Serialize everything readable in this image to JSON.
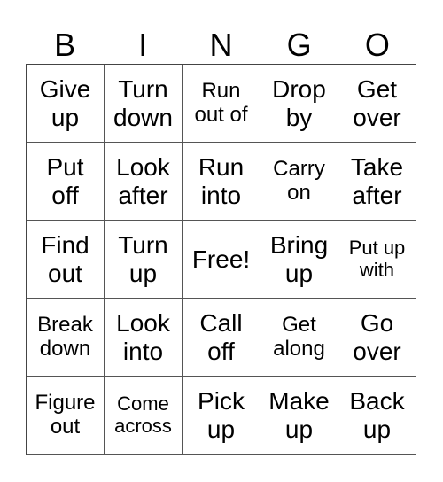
{
  "header": {
    "letters": [
      "B",
      "I",
      "N",
      "G",
      "O"
    ]
  },
  "card": {
    "rows": [
      [
        {
          "line1": "Give",
          "line2": "up",
          "size": "lg"
        },
        {
          "line1": "Turn",
          "line2": "down",
          "size": "lg"
        },
        {
          "line1": "Run",
          "line2": "out of",
          "size": "md"
        },
        {
          "line1": "Drop",
          "line2": "by",
          "size": "lg"
        },
        {
          "line1": "Get",
          "line2": "over",
          "size": "lg"
        }
      ],
      [
        {
          "line1": "Put",
          "line2": "off",
          "size": "lg"
        },
        {
          "line1": "Look",
          "line2": "after",
          "size": "lg"
        },
        {
          "line1": "Run",
          "line2": "into",
          "size": "lg"
        },
        {
          "line1": "Carry",
          "line2": "on",
          "size": "md"
        },
        {
          "line1": "Take",
          "line2": "after",
          "size": "lg"
        }
      ],
      [
        {
          "line1": "Find",
          "line2": "out",
          "size": "lg"
        },
        {
          "line1": "Turn",
          "line2": "up",
          "size": "lg"
        },
        {
          "line1": "Free!",
          "line2": "",
          "size": "free"
        },
        {
          "line1": "Bring",
          "line2": "up",
          "size": "lg"
        },
        {
          "line1": "Put up",
          "line2": "with",
          "size": "sm"
        }
      ],
      [
        {
          "line1": "Break",
          "line2": "down",
          "size": "md"
        },
        {
          "line1": "Look",
          "line2": "into",
          "size": "lg"
        },
        {
          "line1": "Call",
          "line2": "off",
          "size": "lg"
        },
        {
          "line1": "Get",
          "line2": "along",
          "size": "md"
        },
        {
          "line1": "Go",
          "line2": "over",
          "size": "lg"
        }
      ],
      [
        {
          "line1": "Figure",
          "line2": "out",
          "size": "md"
        },
        {
          "line1": "Come",
          "line2": "across",
          "size": "sm"
        },
        {
          "line1": "Pick",
          "line2": "up",
          "size": "lg"
        },
        {
          "line1": "Make",
          "line2": "up",
          "size": "lg"
        },
        {
          "line1": "Back",
          "line2": "up",
          "size": "lg"
        }
      ]
    ]
  }
}
